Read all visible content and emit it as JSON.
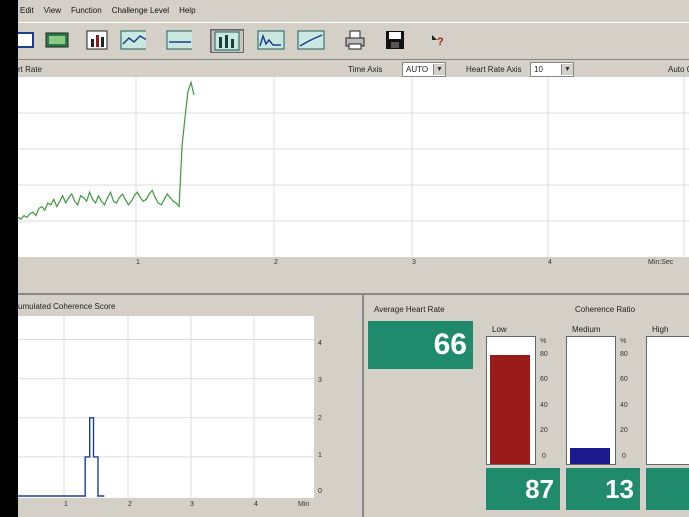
{
  "menu": [
    "Edit",
    "View",
    "Function",
    "Challenge Level",
    "Help"
  ],
  "toolbar_icons": [
    "display-icon",
    "monitor-icon",
    "bar-chart-icon",
    "line-graph-icon",
    "flat-graph-icon",
    "columns-icon",
    "spectrum-icon",
    "trend-icon",
    "print-icon",
    "save-icon",
    "help-icon"
  ],
  "hr_panel": {
    "title": "rt Rate",
    "time_axis_label": "Time Axis",
    "time_axis_value": "AUTO",
    "hr_axis_label": "Heart Rate Axis",
    "hr_axis_value": "10",
    "auto_label": "Auto C",
    "x_ticks": [
      "1",
      "2",
      "3",
      "4"
    ],
    "x_unit": "Min:Sec"
  },
  "coherence_panel": {
    "title": "umulated Coherence Score",
    "y_ticks": [
      "4",
      "3",
      "2",
      "1",
      "0"
    ],
    "x_ticks": [
      "1",
      "2",
      "3",
      "4"
    ],
    "x_unit": "Min"
  },
  "avg_hr": {
    "label": "Average Heart Rate",
    "value": "66"
  },
  "coherence_ratio": {
    "title": "Coherence Ratio",
    "pct_ticks": [
      "%",
      "80",
      "60",
      "40",
      "20",
      "0"
    ],
    "meters": [
      {
        "label": "Low",
        "value_pct": 87,
        "display": "87",
        "color": "#9b1b1b"
      },
      {
        "label": "Medium",
        "value_pct": 13,
        "display": "13",
        "color": "#1a1a8c"
      },
      {
        "label": "High",
        "value_pct": 0,
        "display": "",
        "color": "#1a8c1a"
      }
    ]
  },
  "chart_data": [
    {
      "type": "line",
      "title": "",
      "xlabel": "Min:Sec",
      "x_ticks": [
        "1",
        "2",
        "3",
        "4"
      ],
      "series": [
        {
          "values": [
            22,
            21,
            23,
            22,
            24,
            25,
            23,
            27,
            28,
            26,
            30,
            29,
            32,
            28,
            31,
            34,
            30,
            33,
            35,
            31,
            29,
            34,
            33,
            31,
            36,
            32,
            30,
            34,
            31,
            29,
            33,
            36,
            31,
            30,
            33,
            35,
            32,
            29,
            31,
            34,
            36,
            33,
            31,
            32,
            35,
            37,
            33,
            30,
            29,
            32,
            35,
            33,
            31,
            30,
            28,
            62,
            78,
            92,
            97,
            90
          ]
        }
      ],
      "ylim": [
        0,
        100
      ]
    },
    {
      "type": "line",
      "title": "",
      "xlabel": "Min",
      "x_ticks": [
        "1",
        "2",
        "3",
        "4"
      ],
      "y_ticks": [
        "0",
        "1",
        "2",
        "3",
        "4"
      ],
      "ylim": [
        0,
        4.5
      ],
      "series": [
        {
          "x": [
            0,
            1.0,
            1.05,
            1.05,
            1.12,
            1.12,
            1.18,
            1.18,
            1.25,
            1.25,
            1.35
          ],
          "values": [
            0,
            0,
            0,
            1,
            1,
            2,
            2,
            1,
            1,
            0,
            0
          ]
        }
      ]
    }
  ]
}
